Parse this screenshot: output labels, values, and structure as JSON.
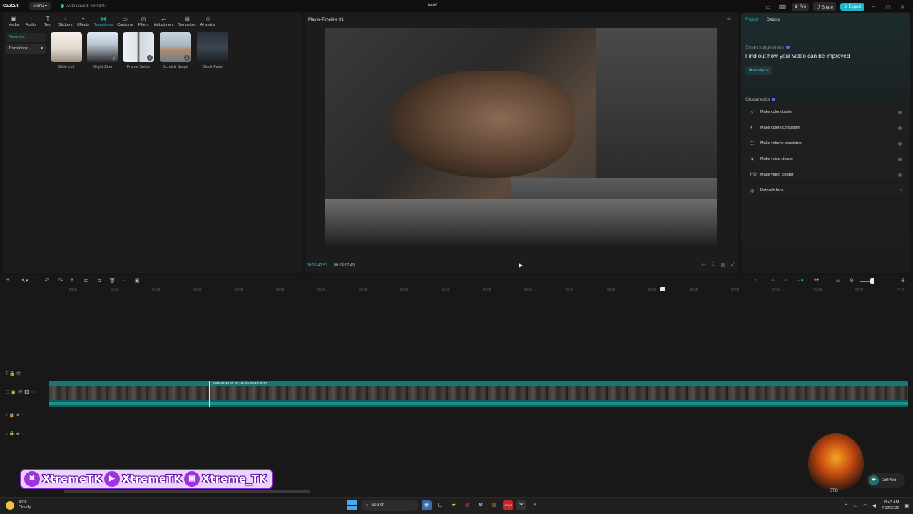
{
  "app": {
    "logo": "CapCut",
    "menu_label": "Menu",
    "autosave_text": "Auto saved: 08:43:07",
    "project_title": "0409",
    "pro_label": "Pro",
    "share_label": "Share",
    "export_label": "Export"
  },
  "toolbar": {
    "tools": [
      {
        "label": "Media",
        "icon": "media-icon",
        "glyph": "▣"
      },
      {
        "label": "Audio",
        "icon": "audio-icon",
        "glyph": "◔"
      },
      {
        "label": "Text",
        "icon": "text-icon",
        "glyph": "T"
      },
      {
        "label": "Stickers",
        "icon": "sticker-icon",
        "glyph": "◌"
      },
      {
        "label": "Effects",
        "icon": "effects-icon",
        "glyph": "✦"
      },
      {
        "label": "Transitions",
        "icon": "transitions-icon",
        "glyph": "⋈"
      },
      {
        "label": "Captions",
        "icon": "captions-icon",
        "glyph": "▭"
      },
      {
        "label": "Filters",
        "icon": "filters-icon",
        "glyph": "◎"
      },
      {
        "label": "Adjustment",
        "icon": "adjustment-icon",
        "glyph": "⇌"
      },
      {
        "label": "Templates",
        "icon": "templates-icon",
        "glyph": "▤"
      },
      {
        "label": "AI avatar",
        "icon": "ai-avatar-icon",
        "glyph": "☺"
      }
    ],
    "active": "Transitions"
  },
  "left_panel": {
    "favorites_label": "Favorites",
    "category_select": "Transitions",
    "transitions": [
      {
        "label": "Slide Left",
        "bg": "linear-gradient(180deg,#f4f0ea 0%,#e2d8cc 55%,#9a8e80 100%)"
      },
      {
        "label": "Slight Jitter",
        "bg": "linear-gradient(180deg,#dfe9f2 0%,#b9c8d6 40%,#2a2a2a 100%)"
      },
      {
        "label": "Frame Swipe",
        "bg": "linear-gradient(90deg,#eef2f6 0%,#dfe5ea 45%,#4a4a4a 50%,#cfd6dc 55%,#e6ebef 100%)"
      },
      {
        "label": "Scratch Swipe",
        "bg": "linear-gradient(180deg,#c7d3e0 0%,#a7b4c2 45%,#b08a6a 60%,#6c7d8c 100%)"
      },
      {
        "label": "Black Fade",
        "bg": "linear-gradient(180deg,#2a3038 0%,#3c4650 50%,#1b1f24 100%)"
      }
    ]
  },
  "player": {
    "title": "Player-Timeline 01",
    "current_time": "00:06:42:57",
    "total_time": "00:24:12:49"
  },
  "right_panel": {
    "tab_project": "Project",
    "tab_details": "Details",
    "smart_heading": "Smart suggestions",
    "smart_desc": "Find out how your video can be improved",
    "analyze_label": "Analyze",
    "global_heading": "Global edits",
    "edits": [
      {
        "label": "Make colors better",
        "icon": "magic-wand-icon",
        "glyph": "✧",
        "type": "toggle"
      },
      {
        "label": "Make colors consistent",
        "icon": "color-match-icon",
        "glyph": "◐",
        "type": "toggle"
      },
      {
        "label": "Make volume consistent",
        "icon": "volume-sliders-icon",
        "glyph": "☷",
        "type": "toggle"
      },
      {
        "label": "Make voice clearer",
        "icon": "voice-icon",
        "glyph": "✦",
        "type": "toggle"
      },
      {
        "label": "Make video clearer",
        "icon": "hd-icon",
        "glyph": "HD",
        "type": "toggle"
      },
      {
        "label": "Retouch face",
        "icon": "retouch-face-icon",
        "glyph": "◍",
        "type": "chevron"
      }
    ]
  },
  "timeline": {
    "ticks": [
      "04:20",
      "04:30",
      "04:40",
      "04:50",
      "05:00",
      "05:10",
      "05:20",
      "05:30",
      "05:40",
      "05:50",
      "06:00",
      "06:10",
      "06:20",
      "06:30",
      "06:40",
      "06:50",
      "07:00",
      "07:10",
      "07:20",
      "07:30",
      "07:40"
    ],
    "clip_label": "2026-03-18 00-25-13.mkv   00:19:05:57"
  },
  "overlay": {
    "banner": [
      "XtremeTK",
      "XtremeTK",
      "Xtreme_TK"
    ],
    "editpilot": "EditPilot",
    "logo_text": "BTC"
  },
  "taskbar": {
    "temperature": "46°F",
    "condition": "Cloudy",
    "search_placeholder": "Search",
    "time": "8:43 AM",
    "date": "4/12/2026"
  }
}
